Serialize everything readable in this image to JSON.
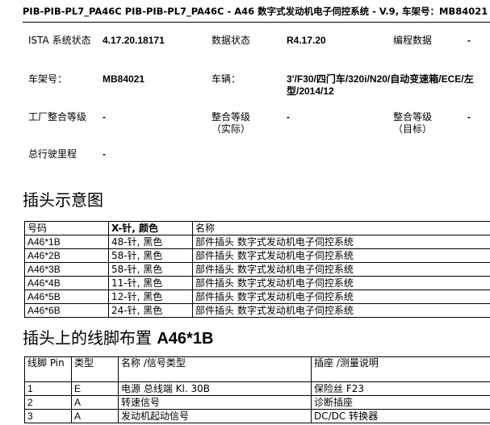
{
  "header": {
    "title": "PIB-PIB-PL7_PA46C   PIB-PIB-PL7_PA46C - A46 数字式发动机电子伺控系统 - V.9,  车架号：MB84021"
  },
  "info": {
    "ista_label": "ISTA 系统状态",
    "ista_value": "4.17.20.18171",
    "data_state_label": "数据状态",
    "data_state_value": "R4.17.20",
    "programming_label": "编程数据",
    "programming_value": "-",
    "vin_label": "车架号：",
    "vin_value": "MB84021",
    "vehicle_label": "车辆：",
    "vehicle_value": "3'/F30/四门车/320i/N20/自动变速箱/ECE/左型/2014/12",
    "factory_level_label": "工厂整合等级",
    "factory_level_value": "-",
    "integration_actual_label": "整合等级（实际）",
    "integration_actual_value": "-",
    "integration_target_label": "整合等级（目标）",
    "integration_target_value": "-",
    "mileage_label": "总行驶里程",
    "mileage_value": "-"
  },
  "plug_section": {
    "heading": "插头示意图",
    "columns": [
      "号码",
      "X-针, 颜色",
      "名称"
    ],
    "rows": [
      [
        "A46*1B",
        "48-针, 黑色",
        "部件插头  数字式发动机电子伺控系统"
      ],
      [
        "A46*2B",
        "58-针, 黑色",
        "部件插头  数字式发动机电子伺控系统"
      ],
      [
        "A46*3B",
        "58-针, 黑色",
        "部件插头  数字式发动机电子伺控系统"
      ],
      [
        "A46*4B",
        "11-针, 黑色",
        "部件插头  数字式发动机电子伺控系统"
      ],
      [
        "A46*5B",
        "12-针, 黑色",
        "部件插头  数字式发动机电子伺控系统"
      ],
      [
        "A46*6B",
        "24-针, 黑色",
        "部件插头  数字式发动机电子伺控系统"
      ]
    ]
  },
  "pin_section": {
    "heading_prefix": "插头上的线脚布置",
    "heading_connector": "A46*1B",
    "columns": [
      "线脚 Pin",
      "类型",
      "名称 /信号类型",
      "插座 /测量说明"
    ],
    "rows": [
      [
        "1",
        "E",
        "电源  总线端  Kl. 30B",
        "保险丝  F23"
      ],
      [
        "2",
        "A",
        "转速信号",
        "诊断插座"
      ],
      [
        "3",
        "A",
        "发动机起动信号",
        "DC/DC 转换器"
      ]
    ]
  }
}
